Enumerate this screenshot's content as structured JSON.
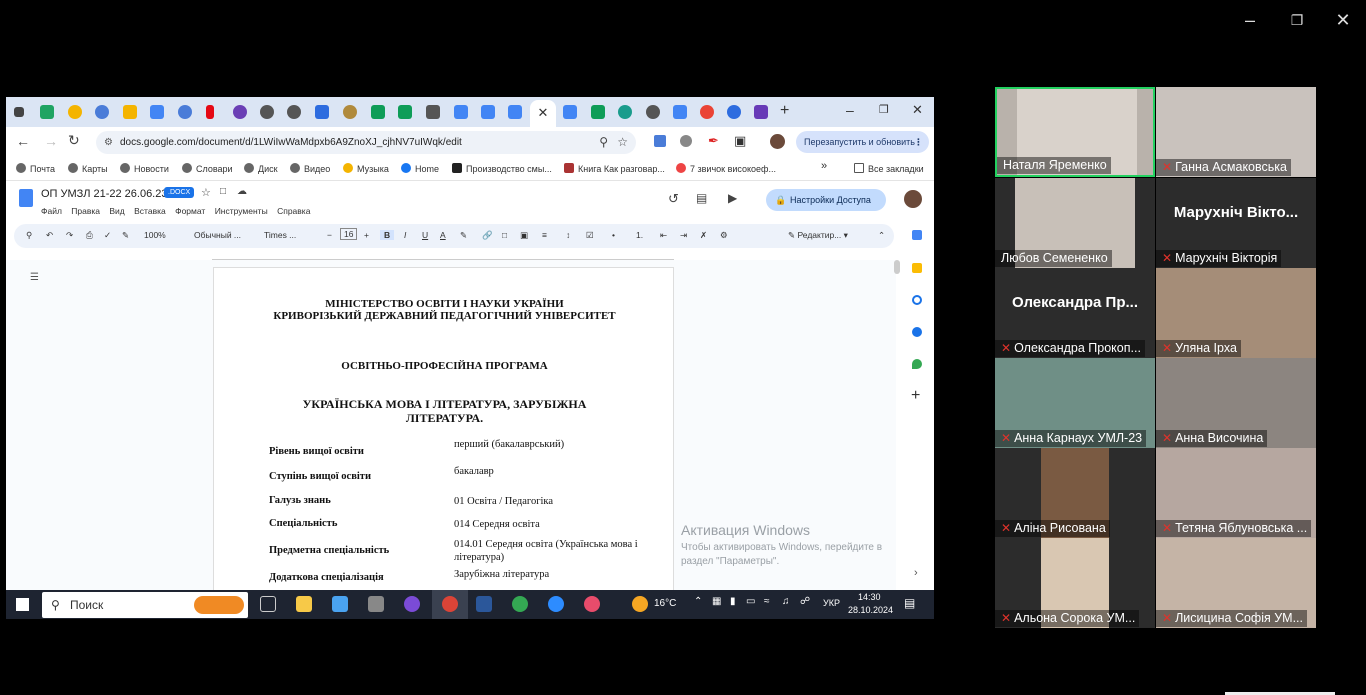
{
  "window": {
    "minimize_icon": "minimize-icon",
    "restore_icon": "restore-icon",
    "close_icon": "close-icon"
  },
  "browser": {
    "url": "docs.google.com/document/d/1LWiIwWaMdpxb6A9ZnoXJ_cjhNV7uIWqk/edit",
    "relaunch_label": "Перезапустить и обновить",
    "bookmarks": [
      "Почта",
      "Карты",
      "Новости",
      "Словари",
      "Диск",
      "Видео",
      "Музыка",
      "Home",
      "Производство смы...",
      "Книга Как разговар...",
      "7 звичок високоеф..."
    ],
    "all_bookmarks": "Все закладки"
  },
  "docs": {
    "title": "ОП УМЗЛ 21-22 26.06.23",
    "badge": ".DOCX",
    "menus": [
      "Файл",
      "Правка",
      "Вид",
      "Вставка",
      "Формат",
      "Инструменты",
      "Справка"
    ],
    "share_label": "Настройки Доступа",
    "toolbar": {
      "zoom": "100%",
      "style": "Обычный ...",
      "font": "Times ...",
      "font_size": "16",
      "mode": "Редактир..."
    }
  },
  "page": {
    "heading1": "МІНІСТЕРСТВО ОСВІТИ І НАУКИ УКРАЇНИ",
    "heading2": "КРИВОРІЗЬКИЙ ДЕРЖАВНИЙ ПЕДАГОГІЧНИЙ УНІВЕРСИТЕТ",
    "program": "ОСВІТНЬО-ПРОФЕСІЙНА ПРОГРАМА",
    "program_name1": "УКРАЇНСЬКА МОВА І ЛІТЕРАТУРА, ЗАРУБІЖНА",
    "program_name2": "ЛІТЕРАТУРА.",
    "rows": [
      {
        "label": "Рівень вищої освіти",
        "value": "перший (бакалаврський)"
      },
      {
        "label": "Ступінь вищої освіти",
        "value": "бакалавр"
      },
      {
        "label": "Галузь знань",
        "value": "01 Освіта / Педагогіка"
      },
      {
        "label": "Спеціальність",
        "value": "014 Середня освіта"
      },
      {
        "label": "Предметна спеціальність",
        "value": "014.01 Середня освіта (Українська мова і література)"
      },
      {
        "label": "Додаткова спеціалізація",
        "value": "Зарубіжна література"
      }
    ]
  },
  "activation": {
    "title": "Активация Windows",
    "text": "Чтобы активировать Windows, перейдите в раздел \"Параметры\"."
  },
  "taskbar": {
    "search": "Поиск",
    "weather": "16°C",
    "lang": "УКР",
    "time": "14:30",
    "date": "28.10.2024"
  },
  "participants": [
    {
      "name": "Наталя Яременко",
      "muted": false,
      "big": ""
    },
    {
      "name": "Ганна Асмаковська",
      "muted": true,
      "big": ""
    },
    {
      "name": "Любов Семененко",
      "muted": false,
      "big": ""
    },
    {
      "name": "Марухніч Вікторія",
      "muted": true,
      "big": "Марухніч Вікто..."
    },
    {
      "name": "Олександра Прокоп...",
      "muted": true,
      "big": "Олександра Пр..."
    },
    {
      "name": "Уляна Ірха",
      "muted": true,
      "big": ""
    },
    {
      "name": "Анна Карнаух УМЛ-23",
      "muted": true,
      "big": ""
    },
    {
      "name": "Анна Височина",
      "muted": true,
      "big": ""
    },
    {
      "name": "Аліна Рисована",
      "muted": true,
      "big": ""
    },
    {
      "name": "Тетяна Яблуновська ...",
      "muted": true,
      "big": ""
    },
    {
      "name": "Альона Сорока УМ...",
      "muted": true,
      "big": ""
    },
    {
      "name": "Лисицина Софія УМ...",
      "muted": true,
      "big": ""
    }
  ]
}
